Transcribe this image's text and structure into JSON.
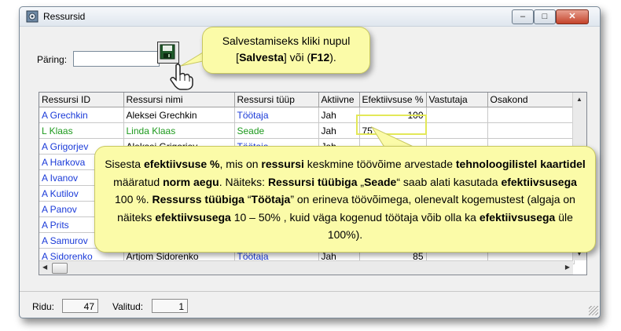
{
  "window": {
    "title": "Ressursid",
    "buttons": {
      "minimize": "–",
      "maximize": "□",
      "close": "✕"
    }
  },
  "query": {
    "label": "Päring:",
    "value": ""
  },
  "grid": {
    "columns": [
      "Ressursi ID",
      "Ressursi nimi",
      "Ressursi tüüp",
      "Aktiivne",
      "Efektiivsuse %",
      "Vastutaja",
      "Osakond"
    ],
    "rows": [
      {
        "id": "A Grechkin",
        "name": "Aleksei Grechkin",
        "type": "Töötaja",
        "active": "Jah",
        "eff": "100",
        "resp": "",
        "dept": ""
      },
      {
        "id": "L Klaas",
        "name": "Linda Klaas",
        "type": "Seade",
        "active": "Jah",
        "eff": "75",
        "resp": "",
        "dept": ""
      },
      {
        "id": "A Grigorjev",
        "name": "Aleksei Grigorjev",
        "type": "Töötaja",
        "active": "Jah",
        "eff": "",
        "resp": "",
        "dept": ""
      },
      {
        "id": "A Harkova",
        "name": "",
        "type": "",
        "active": "",
        "eff": "",
        "resp": "",
        "dept": ""
      },
      {
        "id": "A Ivanov",
        "name": "",
        "type": "",
        "active": "",
        "eff": "",
        "resp": "",
        "dept": ""
      },
      {
        "id": "A Kutilov",
        "name": "",
        "type": "",
        "active": "",
        "eff": "",
        "resp": "",
        "dept": ""
      },
      {
        "id": "A Panov",
        "name": "",
        "type": "",
        "active": "",
        "eff": "",
        "resp": "",
        "dept": ""
      },
      {
        "id": "A Prits",
        "name": "",
        "type": "",
        "active": "",
        "eff": "",
        "resp": "",
        "dept": ""
      },
      {
        "id": "A Samurov",
        "name": "",
        "type": "",
        "active": "",
        "eff": "",
        "resp": "",
        "dept": ""
      },
      {
        "id": "A Sidorenko",
        "name": "Artjom Sidorenko",
        "type": "Töötaja",
        "active": "Jah",
        "eff": "85",
        "resp": "",
        "dept": ""
      }
    ]
  },
  "status": {
    "rows_label": "Ridu:",
    "rows_value": "47",
    "selected_label": "Valitud:",
    "selected_value": "1"
  },
  "callout_save": {
    "line1": "Salvestamiseks kliki nupul",
    "btn_open": "[",
    "btn_name": "Salvesta",
    "btn_mid": "] või (",
    "key": "F12",
    "btn_close": ")."
  },
  "callout_info": {
    "p1": "Sisesta ",
    "b1": "efektiivsuse %",
    "p2": ", mis on ",
    "b2": "ressursi",
    "p3": " keskmine töövõime arvestade ",
    "b3": "tehnoloogilistel kaartidel",
    "p4": " määratud ",
    "b4": "norm aegu",
    "p5": ". Näiteks: ",
    "b5": "Ressursi tüübiga",
    "p6": " „",
    "b6": "Seade",
    "p7": "“ saab alati kasutada ",
    "b7": "efektiivsusega",
    "p8": " 100 %. ",
    "b8": "Ressurss tüübiga",
    "p9": " “",
    "b9": "Töötaja",
    "p10": "” on erineva töövõimega, olenevalt kogemustest (algaja on näiteks ",
    "b10": "efektiivsusega",
    "p11": " 10 – 50% , kuid väga kogenud töötaja võib olla ka ",
    "b11": "efektiivsusega",
    "p12": " üle 100%)."
  },
  "colors": {
    "callout_bg": "#fbfba8",
    "id_link": "#1a3ad8",
    "device_green": "#1e9a1e",
    "highlight": "#e3e858"
  },
  "icons": [
    "app-icon",
    "save-icon",
    "hand-pointer-icon",
    "minimize-icon",
    "maximize-icon",
    "close-icon"
  ]
}
